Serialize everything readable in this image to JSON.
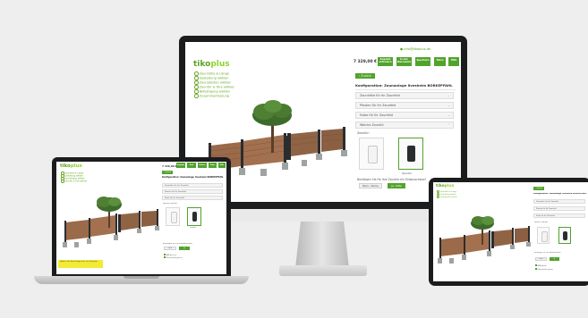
{
  "brand": {
    "name_main": "tiko",
    "name_accent": "plus",
    "accent": "#52a32b",
    "fence_wood": "#9b6a4a",
    "fence_post": "#2a2d30"
  },
  "monitor": {
    "contact": "● info@tikoplus.de",
    "price": "7 329,00 €",
    "toolbar": [
      "Angebot anfordern",
      "In den Warenkorb",
      "Speichern",
      "Teilen",
      "Hilfe"
    ],
    "back": "‹ Zurück",
    "nav": [
      "Zaunhöhe & Länge",
      "Gestaltung wählen",
      "Zaunpfosten wählen",
      "Zauntür & Tore wählen",
      "Befestigung wählen",
      "Zusammenfassung"
    ],
    "title": "Konfiguration: Zaunanlage Ilvesheim BORKEPFAHL",
    "sections": [
      "Zaunhöhe für Ihr Zaunfeld",
      "Pfosten für Ihr Zaunfeld",
      "Farbe für Ihr Zaunfeld"
    ],
    "option_header": "Welche Zauntür",
    "option_sub": "Zauntür:",
    "option_label": "Zauntür",
    "question": "Benötigen Sie für Ihre Zauntür ein Einbauschloss?",
    "btn_no": "Nein, danke",
    "btn_yes": "Ja, bitte"
  },
  "laptop": {
    "price": "7 329,00 €",
    "toolbar": [
      "Angebot",
      "Korb",
      "Sichern",
      "Teilen",
      "Hilfe"
    ],
    "title": "Konfiguration: Zaunanlage Ilvesheim BORKEPFAHL",
    "sections": [
      "Zaunhöhe für Ihr Zaunfeld",
      "Pfosten für Ihr Zaunfeld",
      "Farbe für Ihr Zaunfeld"
    ],
    "option_header": "Welche Zauntür",
    "option_label": "Zauntür",
    "question": "Benötigen Sie ein Einbauschloss?",
    "btn_no": "Nein",
    "btn_yes": "Ja",
    "note": "Hinweis: Die Darstellung ist nur eine Vorschau.",
    "checkbox_1": "AGB gelesen",
    "checkbox_2": "Datenschutz gelesen"
  },
  "tablet": {
    "back": "‹ Zurück",
    "title": "Konfiguration: Zaunanlage Ilvesheim BORKEPFAHL",
    "sections": [
      "Zaunhöhe für Ihr Zaunfeld",
      "Pfosten für Ihr Zaunfeld",
      "Farbe für Ihr Zaunfeld"
    ],
    "option_header": "Welche Zauntür",
    "question": "Benötigen Sie ein Einbauschloss?",
    "btn_no": "Nein",
    "btn_yes": "Ja",
    "checkbox_1": "AGB gelesen",
    "checkbox_2": "Datenschutz gelesen"
  }
}
